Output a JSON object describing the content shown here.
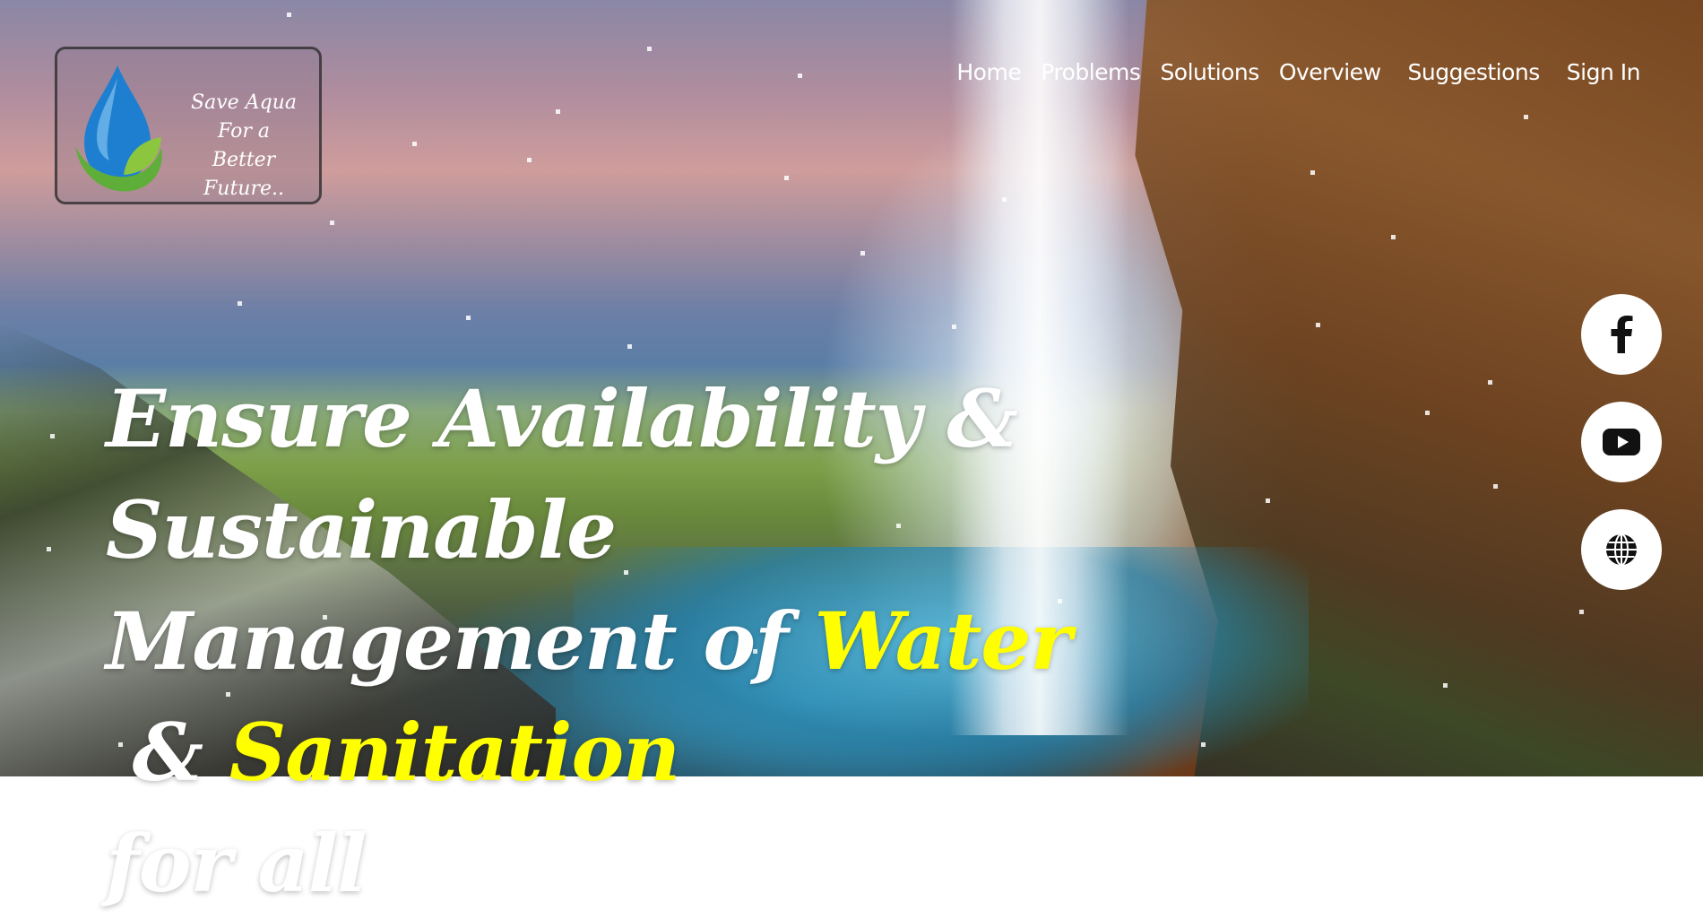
{
  "logo": {
    "line1": "Save Aqua",
    "line2": "For a",
    "line3": "Better Future..",
    "colors": {
      "drop_blue": "#1e7fd0",
      "leaf_green": "#5fae3a"
    }
  },
  "nav": {
    "items": [
      {
        "label": "Home"
      },
      {
        "label": "Problems"
      },
      {
        "label": "Solutions"
      },
      {
        "label": "Overview"
      },
      {
        "label": "Suggestions"
      },
      {
        "label": "Sign In"
      }
    ]
  },
  "hero": {
    "line1": "Ensure Availability & Sustainable",
    "line2_pre": "Management of ",
    "line2_hl1": "Water",
    "line2_mid": " & ",
    "line2_hl2": "Sanitation",
    "line3": "for all",
    "highlight_color": "#ffff00"
  },
  "social": {
    "items": [
      {
        "icon": "facebook-icon"
      },
      {
        "icon": "youtube-icon"
      },
      {
        "icon": "globe-icon"
      }
    ]
  }
}
